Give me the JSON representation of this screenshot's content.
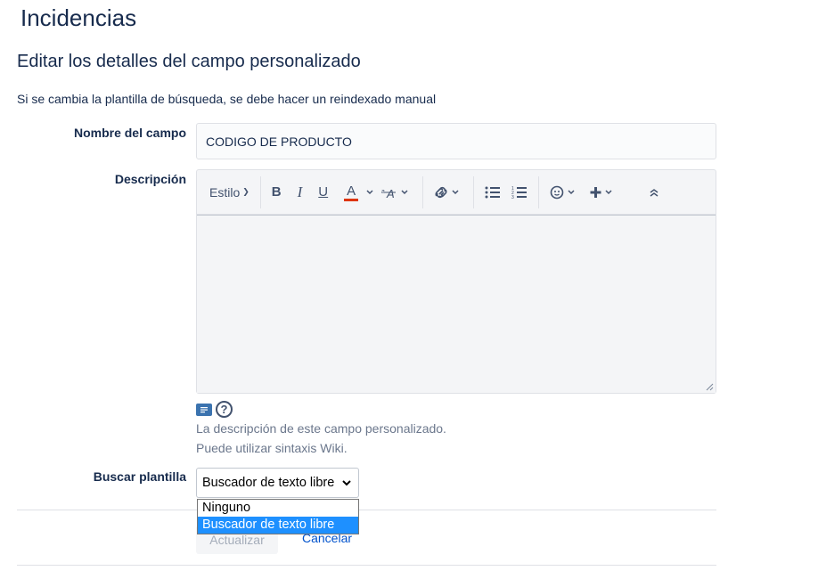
{
  "header": {
    "title": "Incidencias"
  },
  "form": {
    "title": "Editar los detalles del campo personalizado",
    "notice": "Si se cambia la plantilla de búsqueda, se debe hacer un reindexado manual",
    "name_label": "Nombre del campo",
    "name_value": "CODIGO DE PRODUCTO",
    "description_label": "Descripción",
    "description_value": "",
    "hint_line1": "La descripción de este campo personalizado.",
    "hint_line2": "Puede utilizar sintaxis Wiki.",
    "search_label": "Buscar plantilla",
    "search_selected": "Buscador de texto libre",
    "search_options": [
      "Ninguno",
      "Buscador de texto libre"
    ],
    "update_label": "Actualizar",
    "cancel_label": "Cancelar"
  },
  "toolbar": {
    "style_label": "Estilo",
    "bold": "B",
    "italic": "I",
    "underline": "U",
    "text_color": "A",
    "text_color_accent": "#de350b"
  },
  "colors": {
    "accent": "#0052cc",
    "selected_option": "#1e90ff"
  }
}
